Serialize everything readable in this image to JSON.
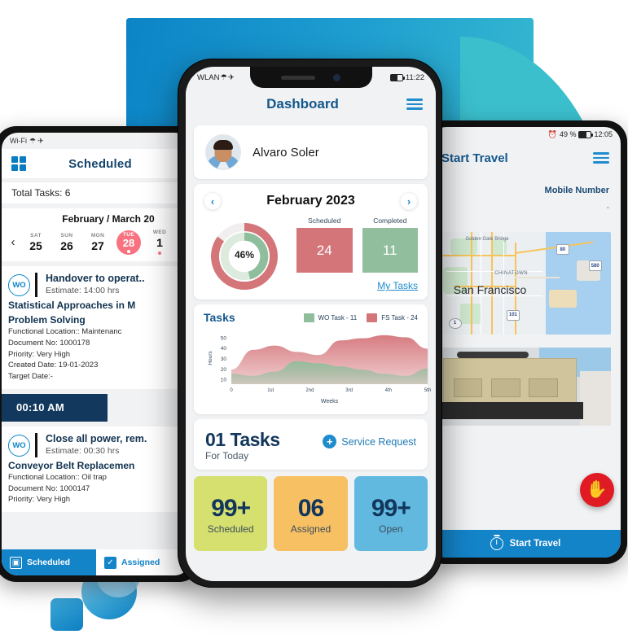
{
  "decor": {
    "blue_rect_color": "#0c84c6",
    "teal_blob_color": "#3bbfcd"
  },
  "left_phone": {
    "status": {
      "network": "Wi-Fi",
      "icons": [
        "wifi-icon",
        "airplane-icon"
      ]
    },
    "header": {
      "title": "Scheduled",
      "menu_icon": "grid-icon"
    },
    "total_tasks": "Total Tasks: 6",
    "calendar": {
      "month_label": "February / March 20",
      "prev_icon": "chevron-left-icon",
      "days": [
        {
          "dow": "SAT",
          "num": "25",
          "active": false,
          "dot": false
        },
        {
          "dow": "SUN",
          "num": "26",
          "active": false,
          "dot": false
        },
        {
          "dow": "MON",
          "num": "27",
          "active": false,
          "dot": false
        },
        {
          "dow": "TUE",
          "num": "28",
          "active": true,
          "dot": true
        },
        {
          "dow": "WED",
          "num": "1",
          "active": false,
          "dot": true
        }
      ]
    },
    "tasks": [
      {
        "badge": "WO",
        "title": "Handover to operat..",
        "estimate": "Estimate: 14:00 hrs",
        "subtitle_line1": "Statistical Approaches in M",
        "subtitle_line2": "Problem Solving",
        "functional_location": "Functional Location:: Maintenanc",
        "document_no": "Document No: 1000178",
        "priority": "Priority: Very High",
        "created_date": "Created Date: 19-01-2023",
        "target_date": "Target Date:-",
        "time_chip": "00:10 AM"
      },
      {
        "badge": "WO",
        "title": "Close all power, rem.",
        "estimate": "Estimate: 00:30 hrs",
        "subtitle_line1": "Conveyor Belt Replacemen",
        "functional_location": "Functional Location:: Oil trap",
        "document_no": "Document No: 1000147",
        "priority": "Priority: Very High"
      }
    ],
    "bottom_nav": [
      {
        "label": "Scheduled",
        "icon": "calendar-icon",
        "active": true
      },
      {
        "label": "Assigned",
        "icon": "check-square-icon",
        "active": false
      }
    ]
  },
  "center_phone": {
    "status": {
      "network": "WLAN",
      "time": "11:22",
      "icons": [
        "wifi-icon",
        "airplane-icon",
        "battery-icon"
      ]
    },
    "header": {
      "title": "Dashboard",
      "menu_icon": "hamburger-icon"
    },
    "profile": {
      "name": "Alvaro Soler",
      "avatar": "user-avatar"
    },
    "calendar": {
      "month": "February 2023",
      "prev_icon": "chevron-left-icon",
      "next_icon": "chevron-right-icon"
    },
    "donut": {
      "percent_label": "46%",
      "outer_value": 85,
      "inner_value": 46,
      "outer_color": "#d4757a",
      "inner_color": "#8fbe9c"
    },
    "stat_boxes": [
      {
        "label": "Scheduled",
        "value": "24",
        "color": "#d4757a"
      },
      {
        "label": "Completed",
        "value": "11",
        "color": "#91bf9d"
      }
    ],
    "my_tasks_link": "My Tasks",
    "tasks_section": {
      "title": "Tasks",
      "legend": [
        {
          "label": "WO Task - 11",
          "color": "#8fbe9c"
        },
        {
          "label": "FS Task - 24",
          "color": "#d4757a"
        }
      ]
    },
    "today": {
      "count_label": "01 Tasks",
      "sub_label": "For Today",
      "service_request": "Service Request",
      "plus_icon": "plus-circle-icon"
    },
    "tiles": [
      {
        "value": "99+",
        "label": "Scheduled",
        "color": "#d5e06e"
      },
      {
        "value": "06",
        "label": "Assigned",
        "color": "#f7c063"
      },
      {
        "value": "99+",
        "label": "Open",
        "color": "#62b9e0"
      }
    ]
  },
  "right_phone": {
    "status": {
      "battery": "49 %",
      "time": "12:05",
      "icons": [
        "alarm-icon",
        "battery-icon"
      ]
    },
    "header": {
      "title": "Start Travel",
      "menu_icon": "hamburger-icon"
    },
    "field": {
      "label": "Mobile Number",
      "value": "-"
    },
    "map": {
      "labels": [
        "Golden Gate Bridge",
        "CHINATOWN",
        "San Francisco"
      ],
      "shields": [
        "80",
        "580",
        "101",
        "1"
      ]
    },
    "stop_icon": "stop-hand-icon",
    "bottom_button": {
      "label": "Start Travel",
      "icon": "stopwatch-icon"
    }
  },
  "chart_data": {
    "type": "area",
    "title": "Tasks",
    "xlabel": "Weeks",
    "ylabel": "Hours",
    "x": [
      "0",
      "1st",
      "2nd",
      "3rd",
      "4th",
      "5th"
    ],
    "yticks": [
      10,
      20,
      30,
      40,
      50
    ],
    "ylim": [
      5,
      55
    ],
    "grid": false,
    "legend_position": "top-right",
    "series": [
      {
        "name": "WO Task - 11",
        "color": "#8fbe9c",
        "values": [
          15,
          13,
          17,
          27,
          25,
          22,
          19,
          15,
          13,
          20
        ]
      },
      {
        "name": "FS Task - 24",
        "color": "#d4757a",
        "values": [
          19,
          38,
          42,
          36,
          33,
          47,
          49,
          52,
          50,
          39
        ]
      }
    ]
  }
}
